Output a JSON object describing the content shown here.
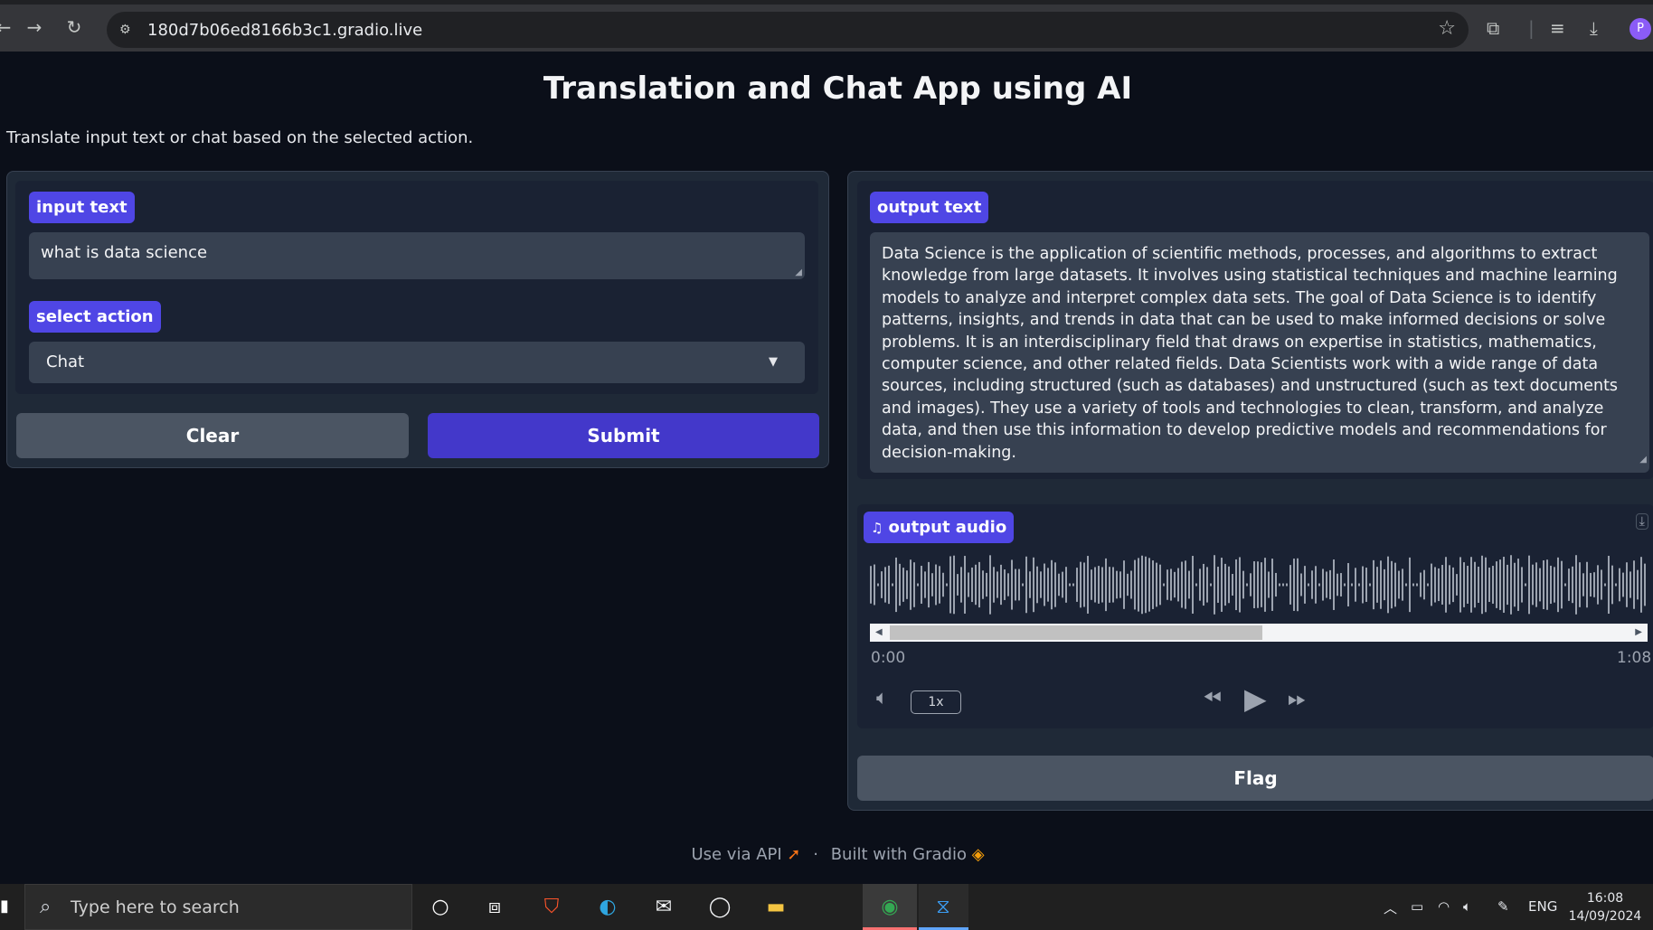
{
  "browser": {
    "url": "180d7b06ed8166b3c1.gradio.live",
    "profile_initial": "P"
  },
  "page": {
    "title": "Translation and Chat App using AI",
    "description": "Translate input text or chat based on the selected action."
  },
  "input_panel": {
    "input_label": "input text",
    "input_value": "what is data science",
    "action_label": "select action",
    "action_value": "Chat",
    "clear_label": "Clear",
    "submit_label": "Submit"
  },
  "output_panel": {
    "output_label": "output text",
    "output_value": "Data Science is the application of scientific methods, processes, and algorithms to extract knowledge from large datasets. It involves using statistical techniques and machine learning models to analyze and interpret complex data sets. The goal of Data Science is to identify patterns, insights, and trends in data that can be used to make informed decisions or solve problems. It is an interdisciplinary field that draws on expertise in statistics, mathematics, computer science, and other related fields. Data Scientists work with a wide range of data sources, including structured (such as databases) and unstructured (such as text documents and images). They use a variety of tools and technologies to clean, transform, and analyze data, and then use this information to develop predictive models and recommendations for decision-making.",
    "audio_label": "output audio",
    "audio_current_time": "0:00",
    "audio_duration": "1:08",
    "playback_speed": "1x",
    "flag_label": "Flag"
  },
  "footer": {
    "api_text": "Use via API",
    "separator": "·",
    "built_text": "Built with Gradio"
  },
  "taskbar": {
    "search_placeholder": "Type here to search",
    "language": "ENG",
    "time": "16:08",
    "date": "14/09/2024"
  },
  "colors": {
    "accent": "#4f46e5",
    "primary_button": "#4338ca",
    "background": "#0b0f19",
    "panel": "#1f2937"
  }
}
